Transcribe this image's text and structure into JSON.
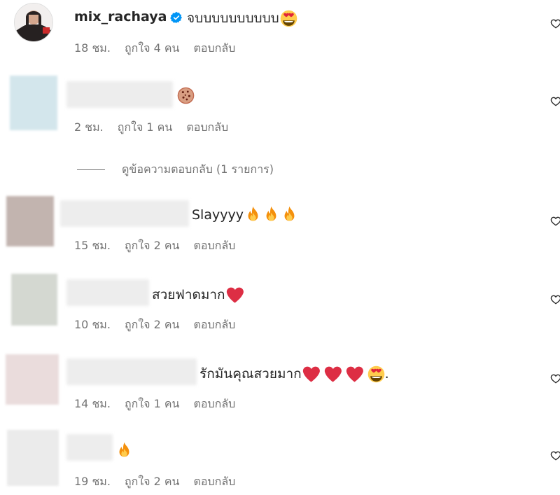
{
  "comments": [
    {
      "username": "mix_rachaya",
      "verified": true,
      "text": "จบบบบบบบบบบ",
      "emojis": [
        "heart-eyes"
      ],
      "time": "18 ชม.",
      "likes": "ถูกใจ 4 คน",
      "reply": "ตอบกลับ"
    },
    {
      "username": "",
      "text": "",
      "emojis": [
        "cookie"
      ],
      "time": "2 ชม.",
      "likes": "ถูกใจ 1 คน",
      "reply": "ตอบกลับ"
    },
    {
      "username": "",
      "text": "Slayyyy",
      "emojis": [
        "fire",
        "fire",
        "fire"
      ],
      "time": "15 ชม.",
      "likes": "ถูกใจ 2 คน",
      "reply": "ตอบกลับ"
    },
    {
      "username": "",
      "text": "สวยฟาดมาก",
      "emojis": [
        "red-heart"
      ],
      "time": "10 ชม.",
      "likes": "ถูกใจ 2 คน",
      "reply": "ตอบกลับ"
    },
    {
      "username": "",
      "text": "รักมันคุณสวยมาก",
      "emojis": [
        "red-heart",
        "red-heart",
        "red-heart",
        "heart-eyes"
      ],
      "trailing": ".",
      "time": "14 ชม.",
      "likes": "ถูกใจ 1 คน",
      "reply": "ตอบกลับ"
    },
    {
      "username": "",
      "text": "",
      "emojis": [
        "fire"
      ],
      "time": "19 ชม.",
      "likes": "ถูกใจ 2 คน",
      "reply": "ตอบกลับ"
    }
  ],
  "view_replies": "ดูข้อความตอบกลับ (1 รายการ)",
  "colors": {
    "text": "#262626",
    "secondary": "#737373",
    "verified": "#0095f6",
    "red": "#e0243a",
    "fire": "#f4900c"
  }
}
